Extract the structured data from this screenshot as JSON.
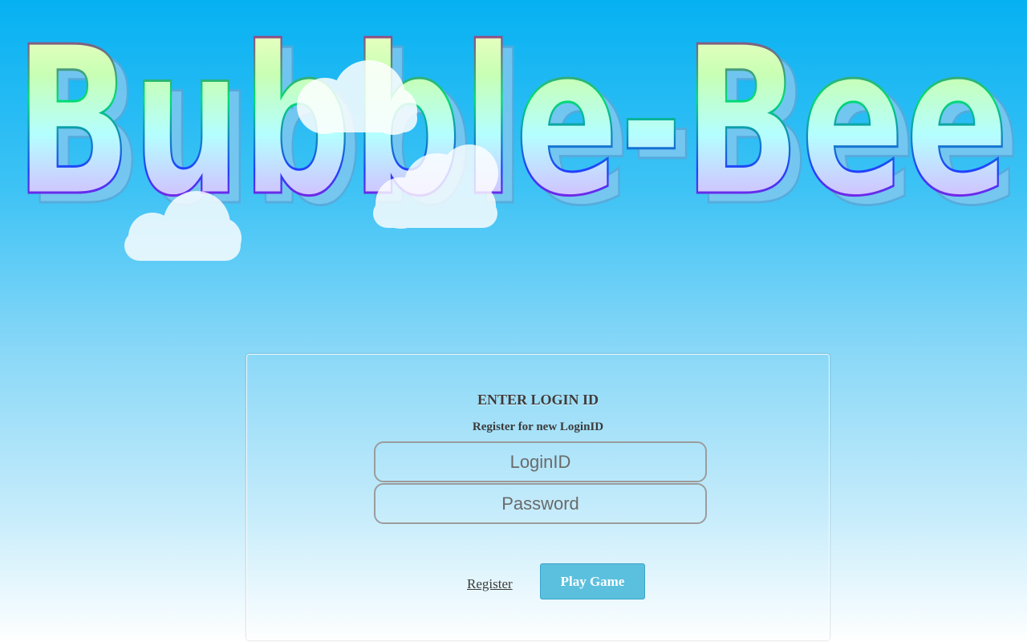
{
  "logo": {
    "text": "Bubble-Bee"
  },
  "login": {
    "heading": "ENTER LOGIN ID",
    "register_hint": "Register for new LoginID",
    "login_id_placeholder": "LoginID",
    "password_placeholder": "Password",
    "register_label": "Register",
    "play_label": "Play Game"
  },
  "colors": {
    "sky_top": "#06b1f2",
    "button_bg": "#5bc0de",
    "text": "#3c3c3c"
  }
}
